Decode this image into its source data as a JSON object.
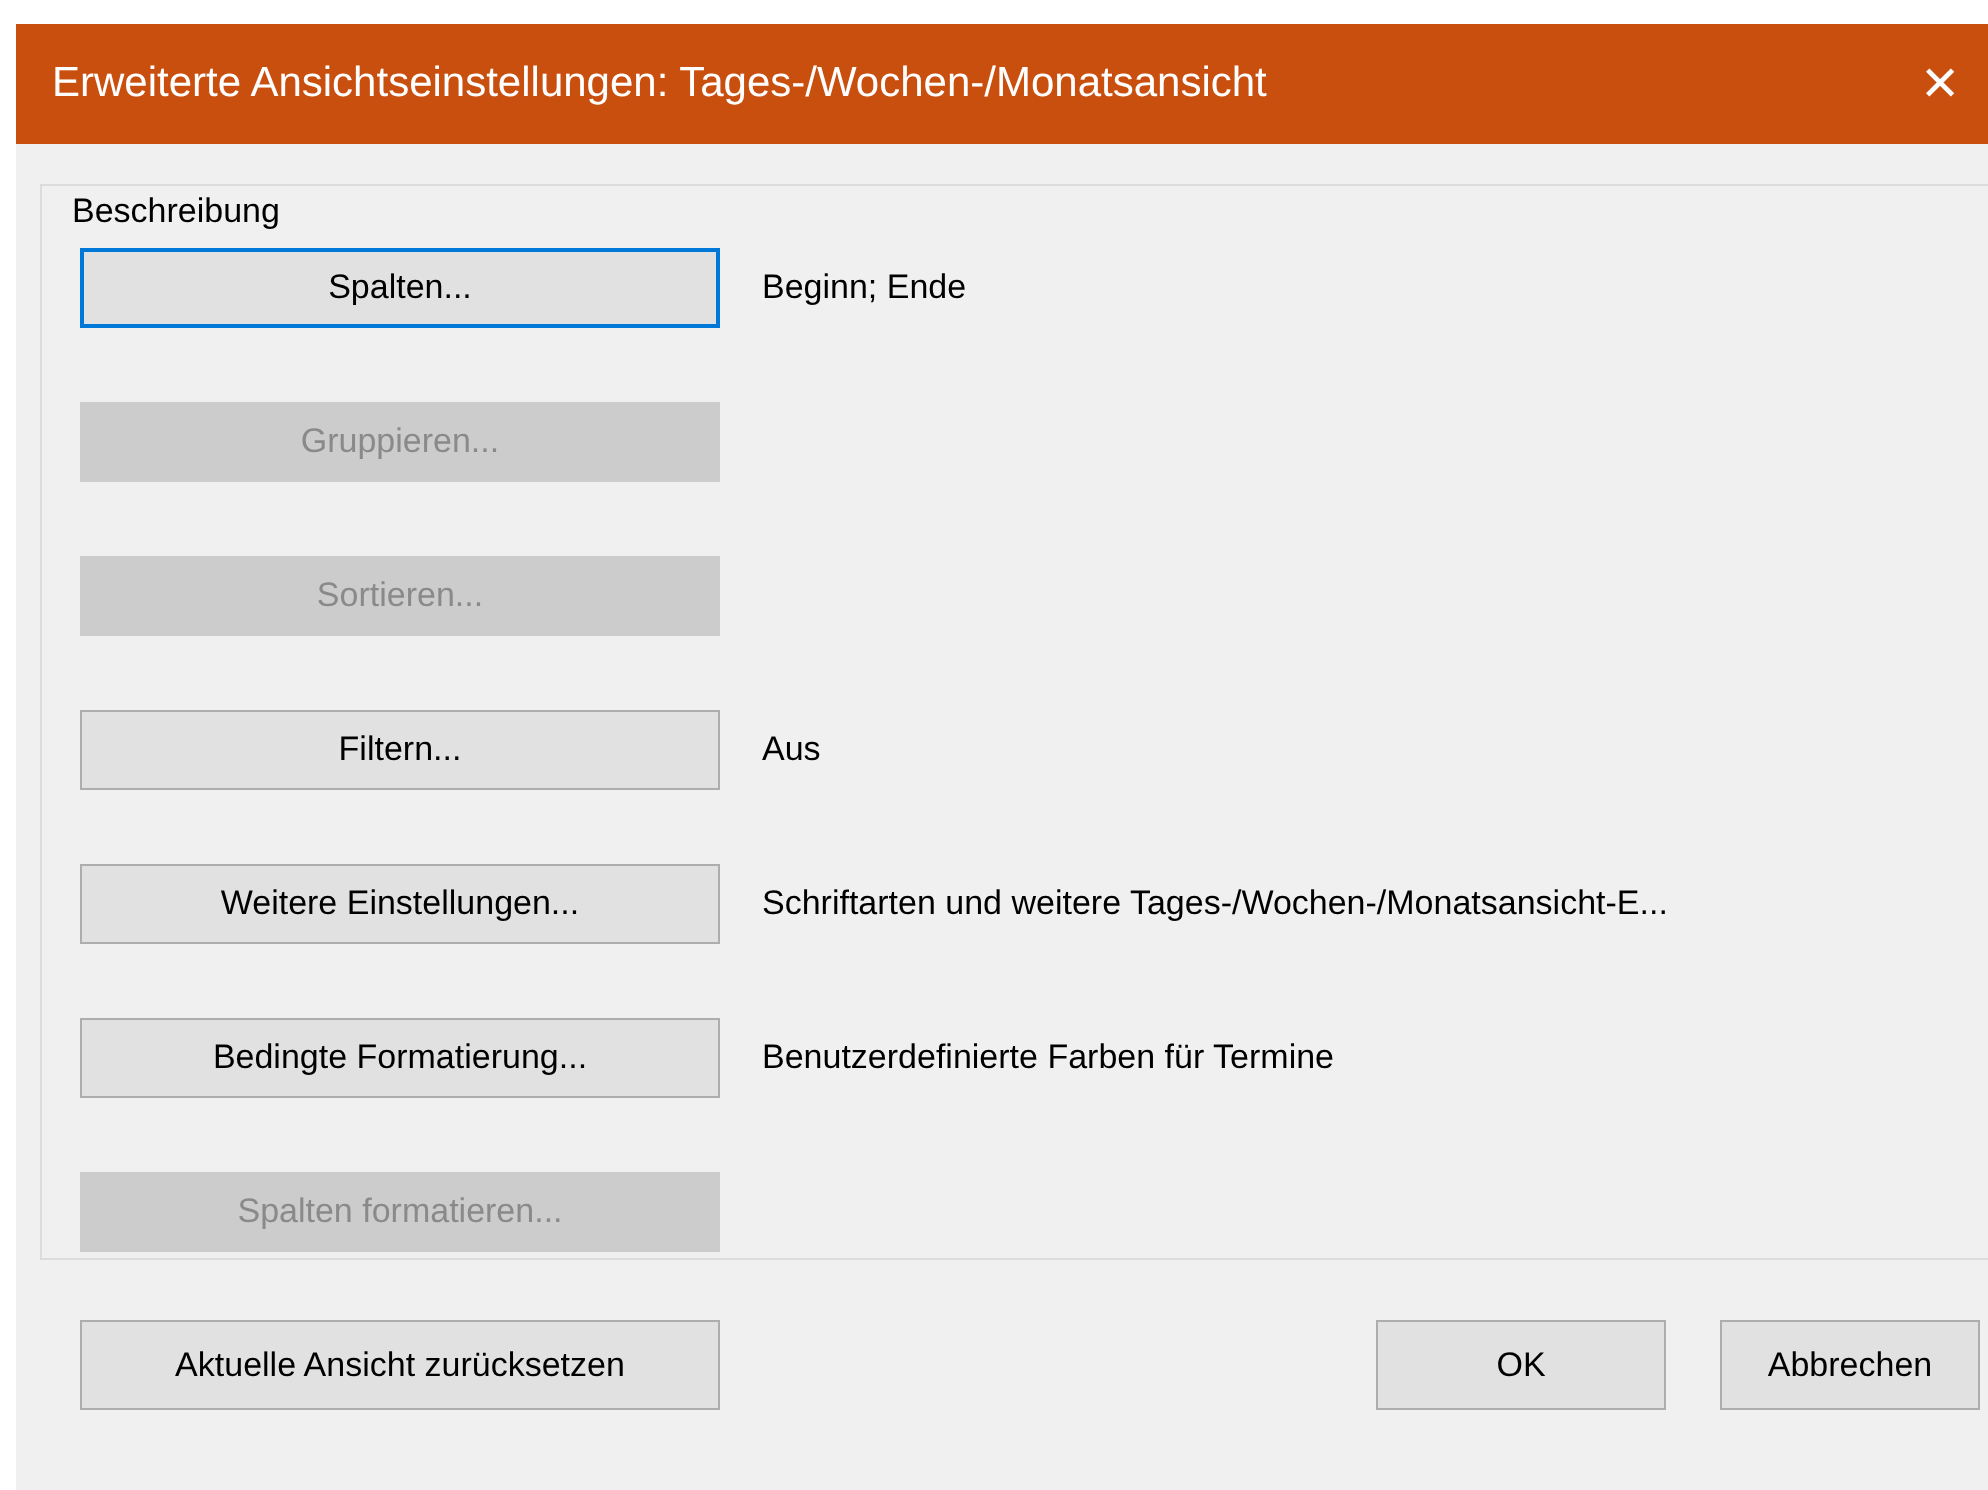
{
  "window": {
    "title": "Erweiterte Ansichtseinstellungen: Tages-/Wochen-/Monatsansicht",
    "close": "✕"
  },
  "group": {
    "label": "Beschreibung",
    "rows": [
      {
        "button": "Spalten...",
        "disabled": false,
        "focused": true,
        "description": "Beginn; Ende"
      },
      {
        "button": "Gruppieren...",
        "disabled": true,
        "focused": false
      },
      {
        "button": "Sortieren...",
        "disabled": true,
        "focused": false
      },
      {
        "button": "Filtern...",
        "disabled": false,
        "focused": false,
        "description": "Aus"
      },
      {
        "button": "Weitere Einstellungen...",
        "disabled": false,
        "focused": false,
        "description": "Schriftarten und weitere Tages-/Wochen-/Monatsansicht-E..."
      },
      {
        "button": "Bedingte Formatierung...",
        "disabled": false,
        "focused": false,
        "description": "Benutzerdefinierte Farben für Termine"
      },
      {
        "button": "Spalten formatieren...",
        "disabled": true,
        "focused": false
      }
    ]
  },
  "footer": {
    "reset": "Aktuelle Ansicht zurücksetzen",
    "ok": "OK",
    "cancel": "Abbrechen"
  }
}
